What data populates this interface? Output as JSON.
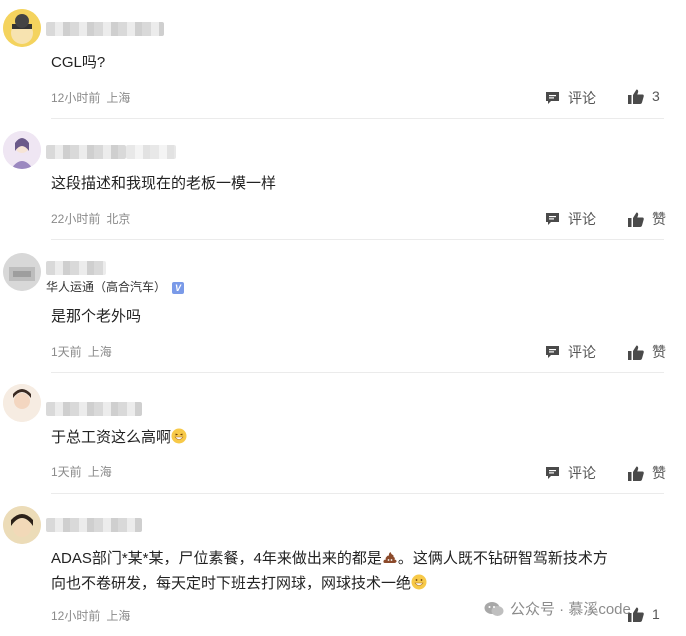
{
  "comments": [
    {
      "name_suffix": "",
      "text": "CGL吗?",
      "time": "12小时前",
      "location": "上海",
      "reply_label": "评论",
      "like_label": "3"
    },
    {
      "name_suffix": "ST",
      "text": "这段描述和我现在的老板一模一样",
      "time": "22小时前",
      "location": "北京",
      "reply_label": "评论",
      "like_label": "赞"
    },
    {
      "name_suffix": "",
      "verified": "华人运通（高合汽车）",
      "text": "是那个老外吗",
      "time": "1天前",
      "location": "上海",
      "reply_label": "评论",
      "like_label": "赞"
    },
    {
      "name_suffix": "2NH",
      "text": "于总工资这么高啊",
      "time": "1天前",
      "location": "上海",
      "reply_label": "评论",
      "like_label": "赞"
    },
    {
      "name_suffix": "",
      "text_line1": "ADAS部门*某*某，尸位素餐，4年来做出来的都是",
      "text_line1b": "。这俩人既不钻研智驾新技术方",
      "text_line2": "向也不卷研发，每天定时下班去打网球，网球技术一绝",
      "time": "12小时前",
      "location": "上海",
      "reply_label": "评论",
      "like_label": "1"
    }
  ],
  "watermark": "公众号 · 慕溪code",
  "icons": {
    "reply": "comment-icon",
    "like": "thumbs-up-icon",
    "poop": "poop-emoji",
    "smile": "grin-emoji"
  }
}
